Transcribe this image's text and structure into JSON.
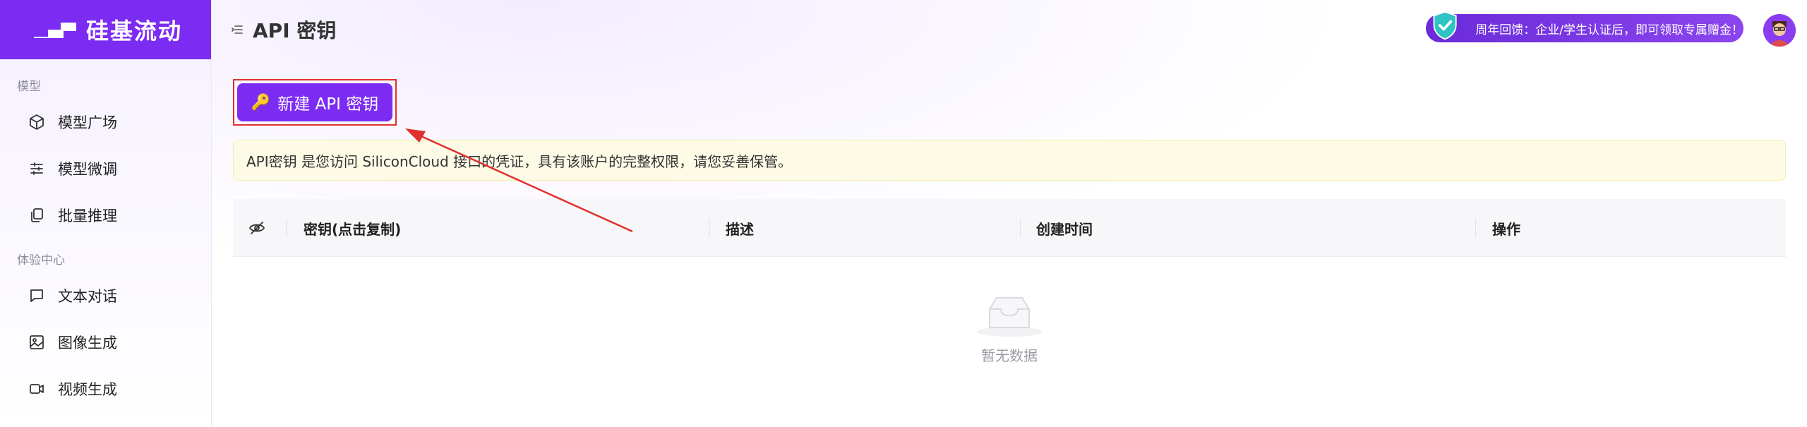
{
  "brand": {
    "name": "硅基流动"
  },
  "sidebar": {
    "groups": [
      {
        "label": "模型",
        "items": [
          {
            "label": "模型广场",
            "icon": "cube-icon"
          },
          {
            "label": "模型微调",
            "icon": "sliders-icon"
          },
          {
            "label": "批量推理",
            "icon": "copy-stack-icon"
          }
        ]
      },
      {
        "label": "体验中心",
        "items": [
          {
            "label": "文本对话",
            "icon": "chat-bubble-icon"
          },
          {
            "label": "图像生成",
            "icon": "image-icon"
          },
          {
            "label": "视频生成",
            "icon": "video-camera-icon"
          }
        ]
      }
    ]
  },
  "header": {
    "title": "API 密钥",
    "promo_text": "周年回馈：企业/学生认证后，即可领取专属赠金！"
  },
  "main": {
    "new_key_button": "新建 API 密钥",
    "notice": "API密钥 是您访问 SiliconCloud 接口的凭证，具有该账户的完整权限，请您妥善保管。",
    "table": {
      "columns": [
        "密钥(点击复制)",
        "描述",
        "创建时间",
        "操作"
      ],
      "rows": [],
      "empty_text": "暂无数据"
    }
  },
  "colors": {
    "brand_purple": "#7c2cf2",
    "highlight_red": "#e0302e",
    "notice_bg": "#fdfbe6"
  }
}
